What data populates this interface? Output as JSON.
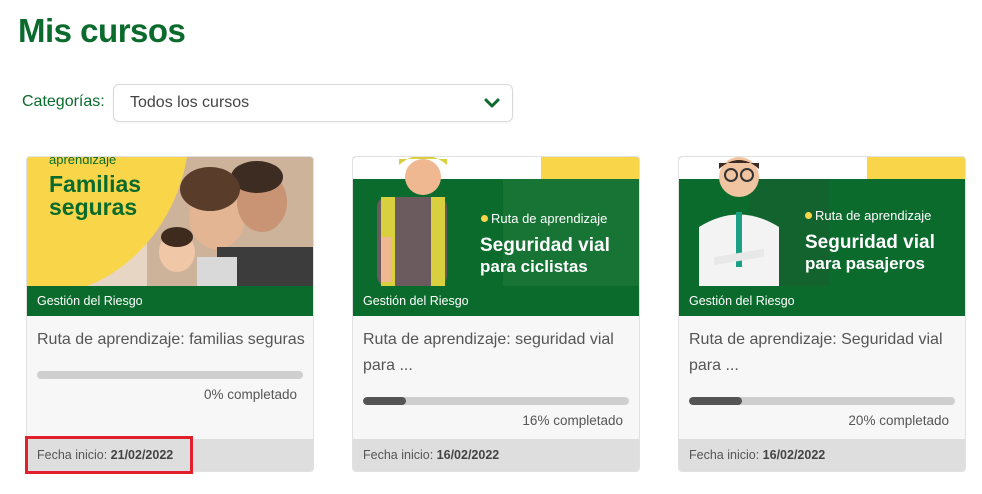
{
  "page": {
    "title": "Mis cursos"
  },
  "filter": {
    "label": "Categorías:",
    "selected": "Todos los cursos"
  },
  "colors": {
    "brand_green": "#0a6b2c",
    "accent_yellow": "#f9d54a",
    "highlight_red": "#e0202a"
  },
  "cards": [
    {
      "banner_tag": "aprendizaje",
      "banner_line1": "Familias",
      "banner_line2": "seguras",
      "category": "Gestión del Riesgo",
      "title": "Ruta de aprendizaje: familias seguras",
      "progress": 0,
      "progress_text": "0% completado",
      "date_label": "Fecha inicio:",
      "date_value": "21/02/2022"
    },
    {
      "banner_tag": "Ruta de aprendizaje",
      "banner_line1": "Seguridad vial",
      "banner_line2": "para ciclistas",
      "category": "Gestión del Riesgo",
      "title": "Ruta de aprendizaje: seguridad vial para ...",
      "progress": 16,
      "progress_text": "16% completado",
      "date_label": "Fecha inicio:",
      "date_value": "16/02/2022"
    },
    {
      "banner_tag": "Ruta de aprendizaje",
      "banner_line1": "Seguridad vial",
      "banner_line2": "para pasajeros",
      "category": "Gestión del Riesgo",
      "title": "Ruta de aprendizaje: Seguridad vial para ...",
      "progress": 20,
      "progress_text": "20% completado",
      "date_label": "Fecha inicio:",
      "date_value": "16/02/2022"
    }
  ]
}
